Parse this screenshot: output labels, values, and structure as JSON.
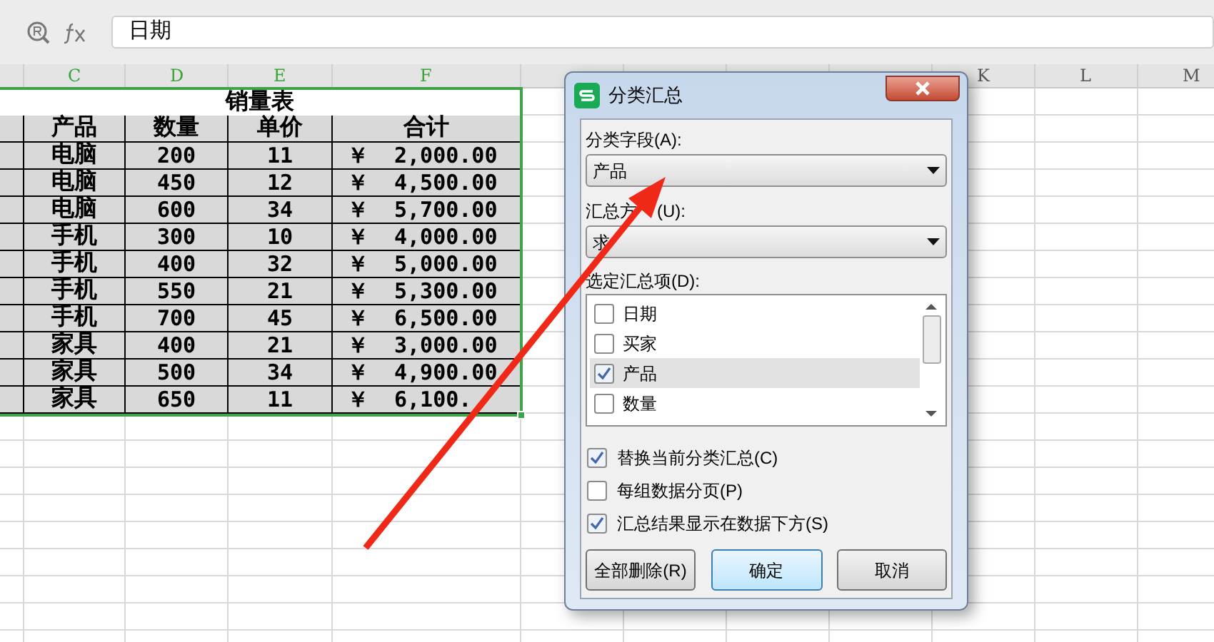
{
  "formula_bar": {
    "content": "日期"
  },
  "columns": [
    {
      "letter": "C"
    },
    {
      "letter": "D"
    },
    {
      "letter": "E"
    },
    {
      "letter": "F"
    },
    {
      "letter": "K"
    },
    {
      "letter": "L"
    },
    {
      "letter": "M"
    }
  ],
  "sheet": {
    "title": "销量表",
    "headers": [
      "产品",
      "数量",
      "单价",
      "合计"
    ],
    "rows": [
      {
        "product": "电脑",
        "qty": "200",
        "price": "11",
        "currency": "￥",
        "total": "2,000.00"
      },
      {
        "product": "电脑",
        "qty": "450",
        "price": "12",
        "currency": "￥",
        "total": "4,500.00"
      },
      {
        "product": "电脑",
        "qty": "600",
        "price": "34",
        "currency": "￥",
        "total": "5,700.00"
      },
      {
        "product": "手机",
        "qty": "300",
        "price": "10",
        "currency": "￥",
        "total": "4,000.00"
      },
      {
        "product": "手机",
        "qty": "400",
        "price": "32",
        "currency": "￥",
        "total": "5,000.00"
      },
      {
        "product": "手机",
        "qty": "550",
        "price": "21",
        "currency": "￥",
        "total": "5,300.00"
      },
      {
        "product": "手机",
        "qty": "700",
        "price": "45",
        "currency": "￥",
        "total": "6,500.00"
      },
      {
        "product": "家具",
        "qty": "400",
        "price": "21",
        "currency": "￥",
        "total": "3,000.00"
      },
      {
        "product": "家具",
        "qty": "500",
        "price": "34",
        "currency": "￥",
        "total": "4,900.00"
      },
      {
        "product": "家具",
        "qty": "650",
        "price": "11",
        "currency": "￥",
        "total": "6,100."
      }
    ]
  },
  "dialog": {
    "title": "分类汇总",
    "group_field": {
      "label": "分类字段(A):",
      "value": "产品"
    },
    "summary_method": {
      "label_parts": [
        "汇总方",
        "(U):"
      ],
      "value": "求"
    },
    "items_label": "选定汇总项(D):",
    "items": [
      {
        "label": "日期",
        "checked": false,
        "selected": false
      },
      {
        "label": "买家",
        "checked": false,
        "selected": false
      },
      {
        "label": "产品",
        "checked": true,
        "selected": true
      },
      {
        "label": "数量",
        "checked": false,
        "selected": false
      }
    ],
    "options": [
      {
        "label": "替换当前分类汇总(C)",
        "checked": true
      },
      {
        "label": "每组数据分页(P)",
        "checked": false
      },
      {
        "label": "汇总结果显示在数据下方(S)",
        "checked": true
      }
    ],
    "buttons": [
      {
        "label": "全部删除(R)",
        "default": false
      },
      {
        "label": "确定",
        "default": true
      },
      {
        "label": "取消",
        "default": false
      }
    ]
  }
}
